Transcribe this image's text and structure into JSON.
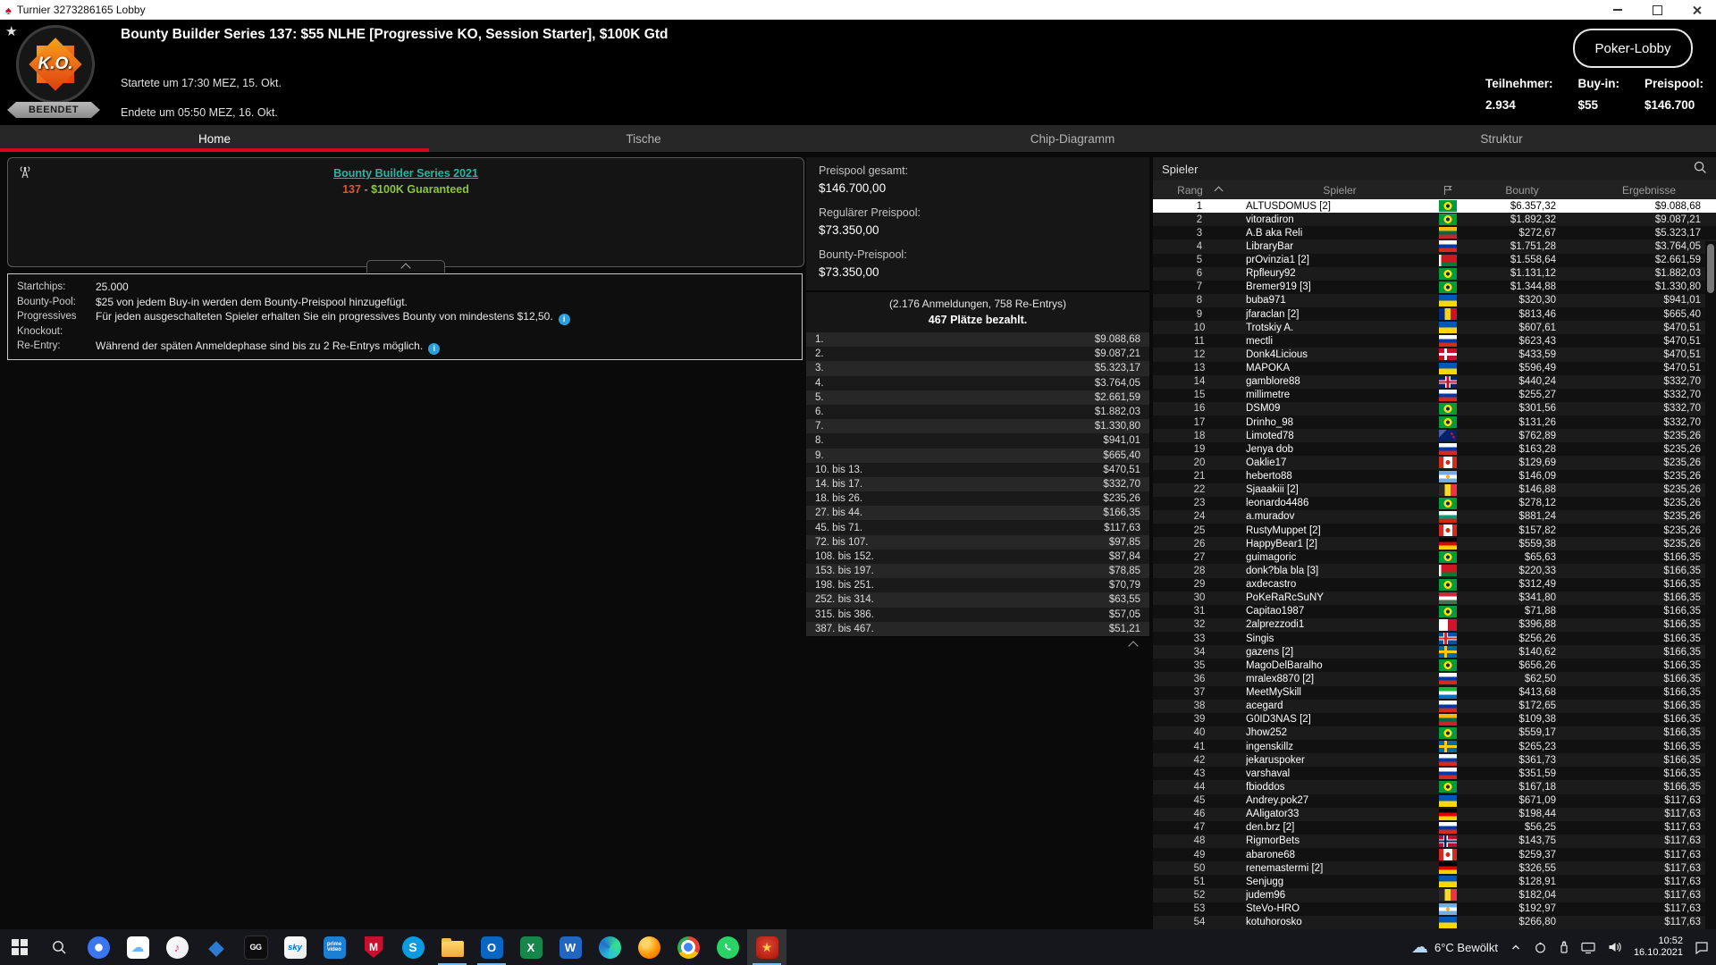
{
  "window": {
    "title": "Turnier 3273286165 Lobby"
  },
  "colors": {
    "accent_red": "#d6081b",
    "link_teal": "#1db9a2",
    "gtd_green": "#8bc53f",
    "series_orange": "#e0532f",
    "info_blue": "#2d9fd8",
    "selected_row_bg": "#ffffff"
  },
  "header": {
    "logo_text": "K.O.",
    "status_badge": "BEENDET",
    "title": "Bounty Builder Series 137: $55 NLHE [Progressive KO, Session Starter], $100K Gtd",
    "started": "Startete um 17:30 MEZ, 15. Okt.",
    "ended": "Endete um 05:50 MEZ, 16. Okt.",
    "lobby_button": "Poker-Lobby",
    "stats": [
      {
        "label": "Teilnehmer:",
        "value": "2.934"
      },
      {
        "label": "Buy-in:",
        "value": "$55"
      },
      {
        "label": "Preispool:",
        "value": "$146.700"
      }
    ]
  },
  "tabs": [
    {
      "label": "Home",
      "active": true
    },
    {
      "label": "Tische",
      "active": false
    },
    {
      "label": "Chip-Diagramm",
      "active": false
    },
    {
      "label": "Struktur",
      "active": false
    }
  ],
  "ad": {
    "line1": "Bounty Builder Series 2021",
    "line2_number": "137",
    "line2_sep": "-",
    "line2_text": "$100K Guaranteed"
  },
  "info_rows": [
    {
      "label": "Startchips:",
      "text": "25.000",
      "info": false
    },
    {
      "label": "Bounty-Pool:",
      "text": "$25 von jedem Buy-in werden dem Bounty-Preispool hinzugefügt.",
      "info": false
    },
    {
      "label": "Progressives Knockout:",
      "text": "Für jeden ausgeschalteten Spieler erhalten Sie ein progressives Bounty von mindestens $12,50.",
      "info": true
    },
    {
      "label": "Re-Entry:",
      "text": "Während der späten Anmeldephase sind bis zu 2 Re-Entrys möglich.",
      "info": true
    }
  ],
  "prize_panel": {
    "total_label": "Preispool gesamt:",
    "total_value": "$146.700,00",
    "regular_label": "Regulärer Preispool:",
    "regular_value": "$73.350,00",
    "bounty_label": "Bounty-Preispool:",
    "bounty_value": "$73.350,00",
    "entries_note": "(2.176 Anmeldungen, 758 Re-Entrys)",
    "places_note": "467 Plätze bezahlt.",
    "prizes": [
      [
        "1.",
        "$9.088,68"
      ],
      [
        "2.",
        "$9.087,21"
      ],
      [
        "3.",
        "$5.323,17"
      ],
      [
        "4.",
        "$3.764,05"
      ],
      [
        "5.",
        "$2.661,59"
      ],
      [
        "6.",
        "$1.882,03"
      ],
      [
        "7.",
        "$1.330,80"
      ],
      [
        "8.",
        "$941,01"
      ],
      [
        "9.",
        "$665,40"
      ],
      [
        "10. bis 13.",
        "$470,51"
      ],
      [
        "14. bis 17.",
        "$332,70"
      ],
      [
        "18. bis 26.",
        "$235,26"
      ],
      [
        "27. bis 44.",
        "$166,35"
      ],
      [
        "45. bis 71.",
        "$117,63"
      ],
      [
        "72. bis 107.",
        "$97,85"
      ],
      [
        "108. bis 152.",
        "$87,84"
      ],
      [
        "153. bis 197.",
        "$78,85"
      ],
      [
        "198. bis 251.",
        "$70,79"
      ],
      [
        "252. bis 314.",
        "$63,55"
      ],
      [
        "315. bis 386.",
        "$57,05"
      ],
      [
        "387. bis 467.",
        "$51,21"
      ]
    ]
  },
  "players_panel": {
    "title": "Spieler",
    "columns": {
      "rank": "Rang",
      "player": "Spieler",
      "bounty": "Bounty",
      "result": "Ergebnisse"
    },
    "selected_rank": 1,
    "rows": [
      [
        1,
        "ALTUSDOMUS [2]",
        "br",
        "$6.357,32",
        "$9.088,68"
      ],
      [
        2,
        "vitoradiron",
        "br",
        "$1.892,32",
        "$9.087,21"
      ],
      [
        3,
        "A.B aka Reli",
        "lt",
        "$272,67",
        "$5.323,17"
      ],
      [
        4,
        "LibraryBar",
        "ru",
        "$1.751,28",
        "$3.764,05"
      ],
      [
        5,
        "prOvinzia1 [2]",
        "by",
        "$1.558,64",
        "$2.661,59"
      ],
      [
        6,
        "Rpfleury92",
        "br",
        "$1.131,12",
        "$1.882,03"
      ],
      [
        7,
        "Bremer919 [3]",
        "br",
        "$1.344,88",
        "$1.330,80"
      ],
      [
        8,
        "buba971",
        "ua",
        "$320,30",
        "$941,01"
      ],
      [
        9,
        "jfaraclan [2]",
        "ro",
        "$813,46",
        "$665,40"
      ],
      [
        10,
        "Trotskiy A.",
        "ua",
        "$607,61",
        "$470,51"
      ],
      [
        11,
        "mectli",
        "ru",
        "$623,43",
        "$470,51"
      ],
      [
        12,
        "Donk4Licious",
        "dk",
        "$433,59",
        "$470,51"
      ],
      [
        13,
        "MAPOKA",
        "ua",
        "$596,49",
        "$470,51"
      ],
      [
        14,
        "gamblore88",
        "gb",
        "$440,24",
        "$332,70"
      ],
      [
        15,
        "millimetre",
        "ru",
        "$255,27",
        "$332,70"
      ],
      [
        16,
        "DSM09",
        "br",
        "$301,56",
        "$332,70"
      ],
      [
        17,
        "Drinho_98",
        "br",
        "$131,26",
        "$332,70"
      ],
      [
        18,
        "Limoted78",
        "nz",
        "$762,89",
        "$235,26"
      ],
      [
        19,
        "Jenya dob",
        "ru",
        "$163,28",
        "$235,26"
      ],
      [
        20,
        "Oaklie17",
        "ca",
        "$129,69",
        "$235,26"
      ],
      [
        21,
        "heberto88",
        "ar",
        "$146,09",
        "$235,26"
      ],
      [
        22,
        "Sjaaakiii [2]",
        "be",
        "$146,88",
        "$235,26"
      ],
      [
        23,
        "leonardo4486",
        "br",
        "$278,12",
        "$235,26"
      ],
      [
        24,
        "a.muradov",
        "bg",
        "$881,24",
        "$235,26"
      ],
      [
        25,
        "RustyMuppet [2]",
        "ca",
        "$157,82",
        "$235,26"
      ],
      [
        26,
        "HappyBear1 [2]",
        "de",
        "$559,38",
        "$235,26"
      ],
      [
        27,
        "guimagoric",
        "br",
        "$65,63",
        "$166,35"
      ],
      [
        28,
        "donk?bla bla [3]",
        "by",
        "$220,33",
        "$166,35"
      ],
      [
        29,
        "axdecastro",
        "br",
        "$312,49",
        "$166,35"
      ],
      [
        30,
        "PoKeRaRcSuNY",
        "hu",
        "$341,80",
        "$166,35"
      ],
      [
        31,
        "Capitao1987",
        "br",
        "$71,88",
        "$166,35"
      ],
      [
        32,
        "2alprezzodi1",
        "mt",
        "$396,88",
        "$166,35"
      ],
      [
        33,
        "Singis",
        "is",
        "$256,26",
        "$166,35"
      ],
      [
        34,
        "gazens [2]",
        "se",
        "$140,62",
        "$166,35"
      ],
      [
        35,
        "MagoDelBaralho",
        "br",
        "$656,26",
        "$166,35"
      ],
      [
        36,
        "mralex8870 [2]",
        "ru",
        "$62,50",
        "$166,35"
      ],
      [
        37,
        "MeetMySkill",
        "sl",
        "$413,68",
        "$166,35"
      ],
      [
        38,
        "acegard",
        "ru",
        "$172,65",
        "$166,35"
      ],
      [
        39,
        "G0ID3NAS [2]",
        "lt",
        "$109,38",
        "$166,35"
      ],
      [
        40,
        "Jhow252",
        "br",
        "$559,17",
        "$166,35"
      ],
      [
        41,
        "ingenskillz",
        "se",
        "$265,23",
        "$166,35"
      ],
      [
        42,
        "jekaruspoker",
        "ru",
        "$361,73",
        "$166,35"
      ],
      [
        43,
        "varshaval",
        "ru",
        "$351,59",
        "$166,35"
      ],
      [
        44,
        "fbioddos",
        "br",
        "$167,18",
        "$166,35"
      ],
      [
        45,
        "Andrey.pok27",
        "ua",
        "$671,09",
        "$117,63"
      ],
      [
        46,
        "AAligator33",
        "de",
        "$198,44",
        "$117,63"
      ],
      [
        47,
        "den.brz [2]",
        "ru",
        "$56,25",
        "$117,63"
      ],
      [
        48,
        "RigmorBets",
        "no",
        "$143,75",
        "$117,63"
      ],
      [
        49,
        "abarone68",
        "ca",
        "$259,37",
        "$117,63"
      ],
      [
        50,
        "renemastermi [2]",
        "de",
        "$326,55",
        "$117,63"
      ],
      [
        51,
        "Senjugg",
        "ua",
        "$128,91",
        "$117,63"
      ],
      [
        52,
        "judem96",
        "be",
        "$182,04",
        "$117,63"
      ],
      [
        53,
        "SteVo-HRO",
        "ar",
        "$192,97",
        "$117,63"
      ],
      [
        54,
        "kotuhorosko",
        "ua",
        "$266,80",
        "$117,63"
      ]
    ]
  },
  "taskbar": {
    "pinned_icons": [
      "windows-start",
      "search",
      "signal",
      "icloud",
      "itunes",
      "stars-app",
      "ggpoker",
      "sky",
      "prime-video",
      "mcafee",
      "skype",
      "file-explorer",
      "outlook",
      "excel",
      "word",
      "edge",
      "firefox",
      "chrome",
      "whatsapp",
      "pokerstars"
    ],
    "open_apps": [
      "file-explorer",
      "outlook",
      "pokerstars"
    ],
    "active_app": "pokerstars",
    "tray": {
      "weather": "6°C Bewölkt",
      "time": "10:52",
      "date": "16.10.2021"
    }
  }
}
